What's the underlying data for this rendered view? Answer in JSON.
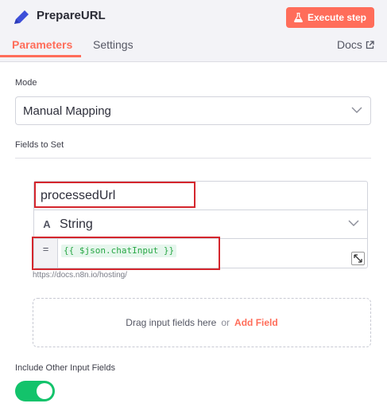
{
  "node": {
    "title": "PrepareURL",
    "icon": "pencil-icon"
  },
  "header": {
    "execute_label": "Execute step",
    "execute_icon": "flask-icon"
  },
  "tabs": {
    "parameters": "Parameters",
    "settings": "Settings",
    "docs": "Docs"
  },
  "mode": {
    "label": "Mode",
    "value": "Manual Mapping"
  },
  "fields_to_set": {
    "label": "Fields to Set",
    "field": {
      "name": "processedUrl",
      "type_icon": "A",
      "type": "String",
      "value_prefix": "=",
      "value": "{{ $json.chatInput }}"
    },
    "hint": "https://docs.n8n.io/hosting/"
  },
  "dropzone": {
    "text": "Drag input fields here",
    "or": "or",
    "add_field": "Add Field"
  },
  "include_other": {
    "label": "Include Other Input Fields",
    "enabled": true
  },
  "colors": {
    "accent": "#ff6d5a",
    "toggle_on": "#13c36b",
    "highlight_box": "#d4262d"
  }
}
